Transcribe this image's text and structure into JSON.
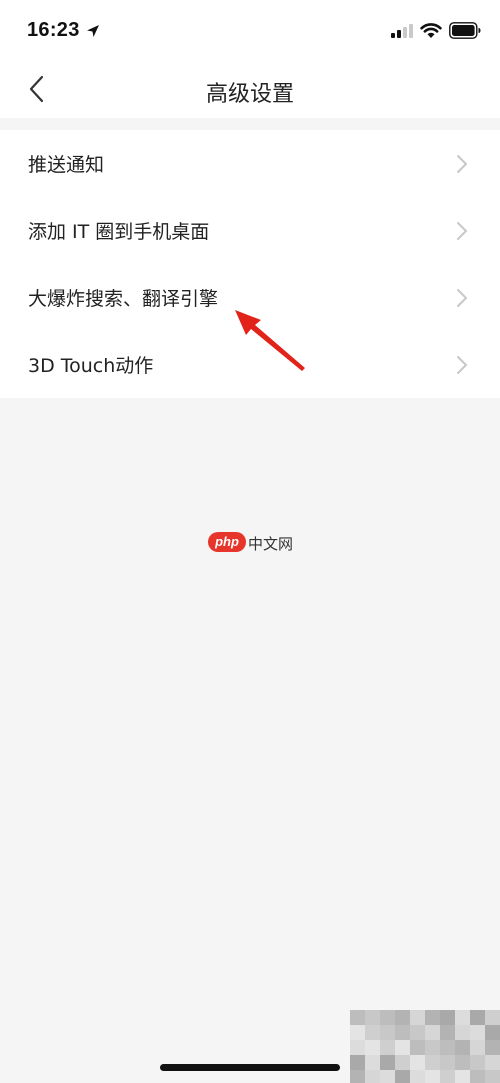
{
  "status_bar": {
    "time": "16:23",
    "icons": [
      "location-icon",
      "cell-signal-icon",
      "wifi-icon",
      "battery-icon"
    ]
  },
  "nav": {
    "back_icon": "chevron-left-icon",
    "title": "高级设置"
  },
  "menu": {
    "items": [
      {
        "label": "推送通知",
        "icon": "chevron-right-icon"
      },
      {
        "label": "添加 IT 圈到手机桌面",
        "icon": "chevron-right-icon"
      },
      {
        "label": "大爆炸搜索、翻译引擎",
        "icon": "chevron-right-icon"
      },
      {
        "label": "3D Touch动作",
        "icon": "chevron-right-icon"
      }
    ]
  },
  "watermark": {
    "badge": "php",
    "text": "中文网"
  },
  "colors": {
    "background": "#f5f5f5",
    "surface": "#ffffff",
    "text": "#222222",
    "chevron": "#c7c7cc",
    "annotation_arrow": "#e2231a",
    "watermark_red": "#e8352b"
  }
}
